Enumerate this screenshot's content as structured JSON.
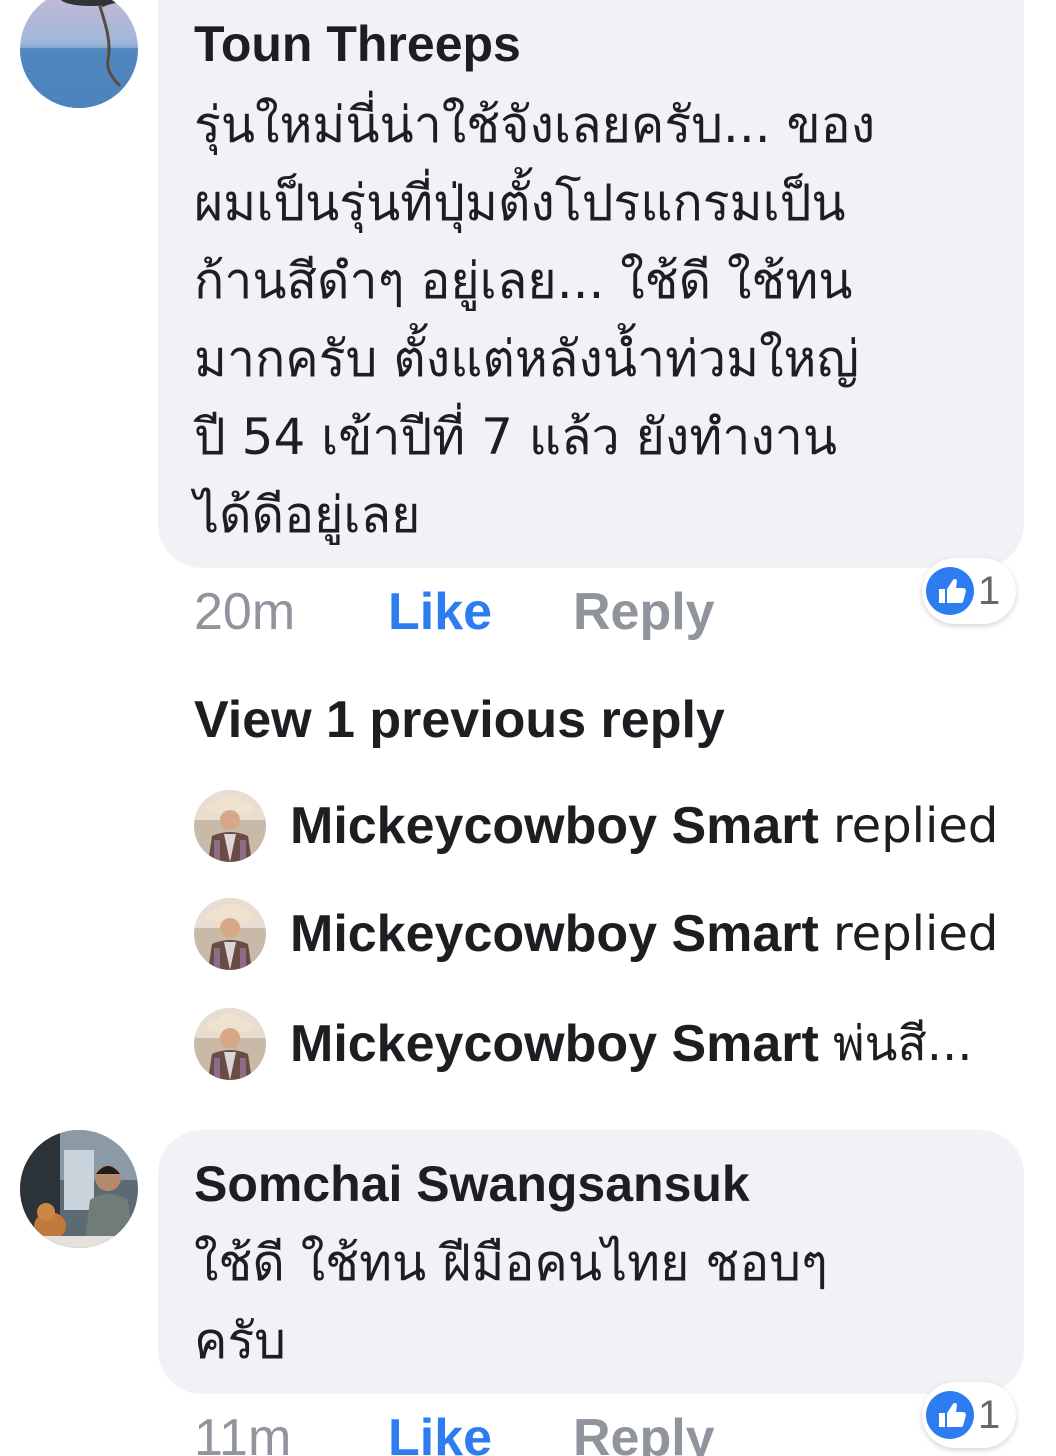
{
  "comments": [
    {
      "author": "Toun Threeps",
      "text": "รุ่นใหม่นี่น่าใช้จังเลยครับ... ของ\nผมเป็นรุ่นที่ปุ่มตั้งโปรแกรมเป็น\nก้านสีดำๆ อยู่เลย... ใช้ดี ใช้ทน\nมากครับ ตั้งแต่หลังน้ำท่วมใหญ่\nปี 54 เข้าปีที่ 7 แล้ว ยังทำงาน\nได้ดีอยู่เลย",
      "time": "20m",
      "like_label": "Like",
      "reply_label": "Reply",
      "reaction_count": "1"
    },
    {
      "author": "Somchai Swangsansuk",
      "text": "ใช้ดี ใช้ทน ฝีมือคนไทย ชอบๆ\nครับ",
      "time": "11m",
      "like_label": "Like",
      "reply_label": "Reply",
      "reaction_count": "1"
    }
  ],
  "view_previous_label": "View 1 previous reply",
  "replies": [
    {
      "author": "Mickeycowboy Smart",
      "snippet": "replied"
    },
    {
      "author": "Mickeycowboy Smart",
      "snippet": "replied"
    },
    {
      "author": "Mickeycowboy Smart",
      "snippet": "พ่นสี..."
    }
  ],
  "colors": {
    "bubble": "#f0f2f5",
    "like_blue": "#2d7df0",
    "muted": "#90949c",
    "text": "#1c1e21"
  },
  "icons": {
    "reaction": "thumbs-up-icon"
  }
}
